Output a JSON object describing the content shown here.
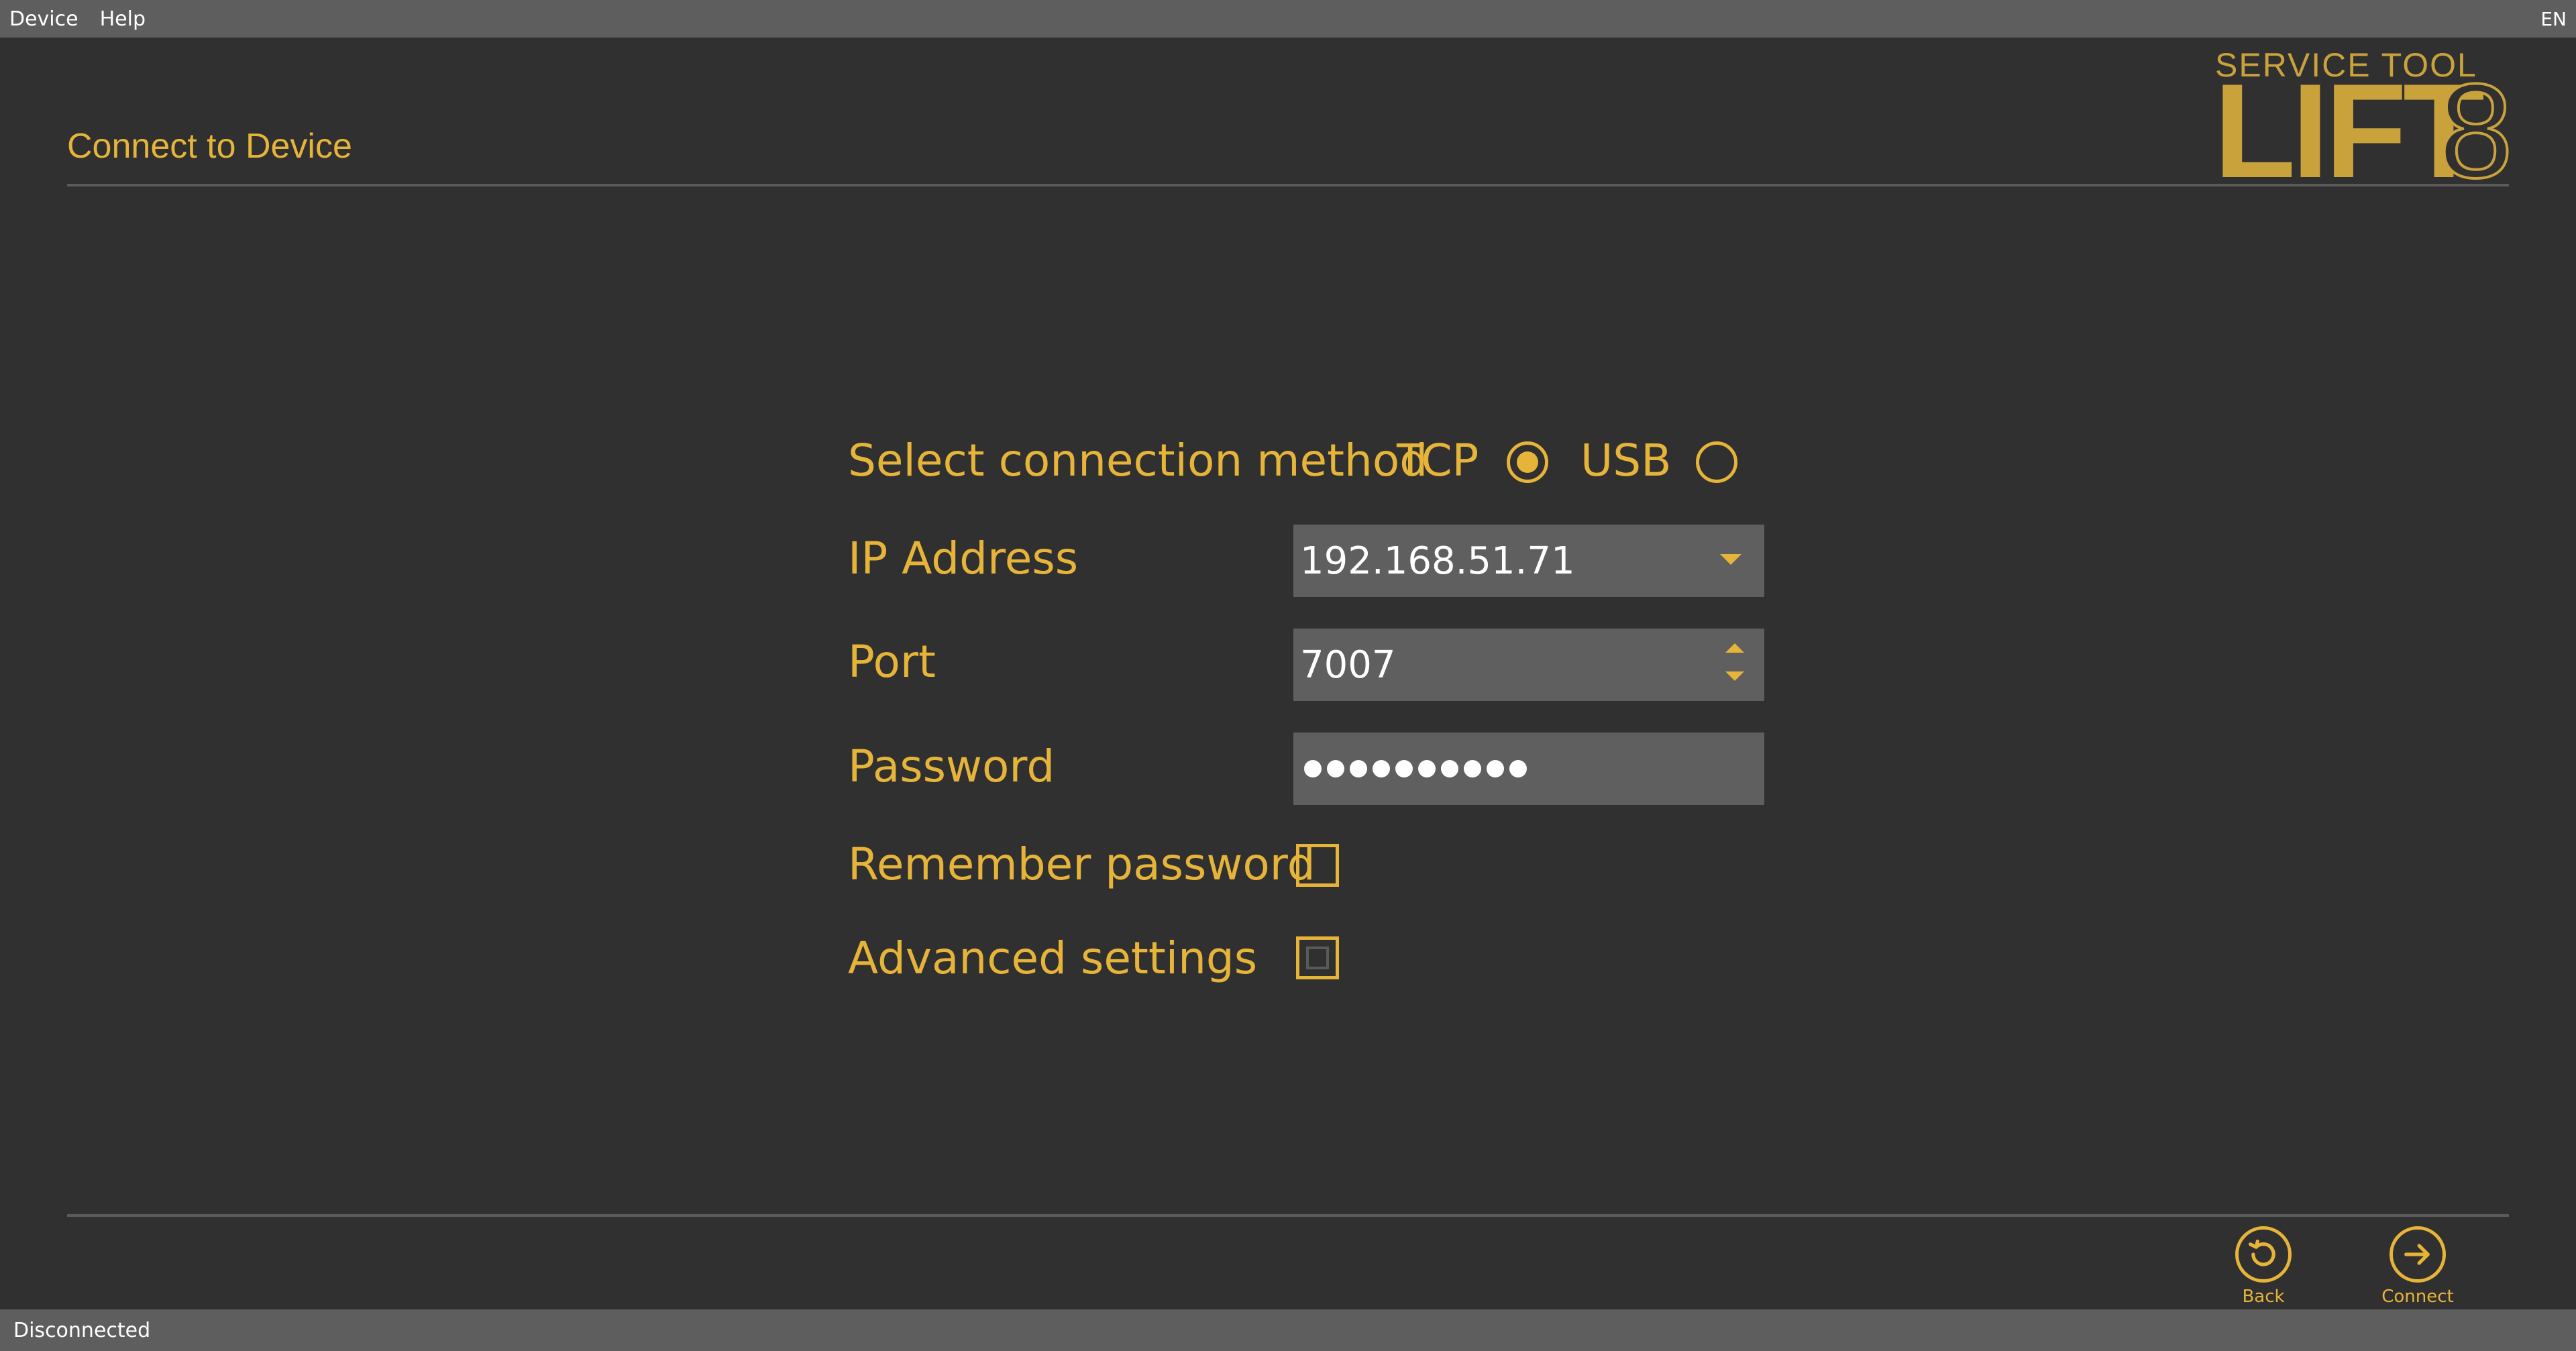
{
  "menu": {
    "items": [
      "Device",
      "Help"
    ],
    "language": "EN"
  },
  "header": {
    "title": "Connect to Device"
  },
  "logo": {
    "subtitle": "SERVICE TOOL",
    "main": "LIFT",
    "digit": "8"
  },
  "form": {
    "connection_label": "Select connection method",
    "options": [
      {
        "label": "TCP",
        "selected": true
      },
      {
        "label": "USB",
        "selected": false
      }
    ],
    "ip_label": "IP Address",
    "ip_value": "192.168.51.71",
    "port_label": "Port",
    "port_value": "7007",
    "password_label": "Password",
    "password_length": 10,
    "remember_label": "Remember password",
    "remember_checked": false,
    "advanced_label": "Advanced settings",
    "advanced_checked": false
  },
  "actions": {
    "back_label": "Back",
    "connect_label": "Connect"
  },
  "status": {
    "text": "Disconnected"
  },
  "colors": {
    "accent": "#e7b43a",
    "background": "#303030",
    "bar": "#5e5e5e",
    "field": "#5f5f5f"
  },
  "icons": {
    "back": "undo-icon",
    "connect": "arrow-right-icon"
  }
}
